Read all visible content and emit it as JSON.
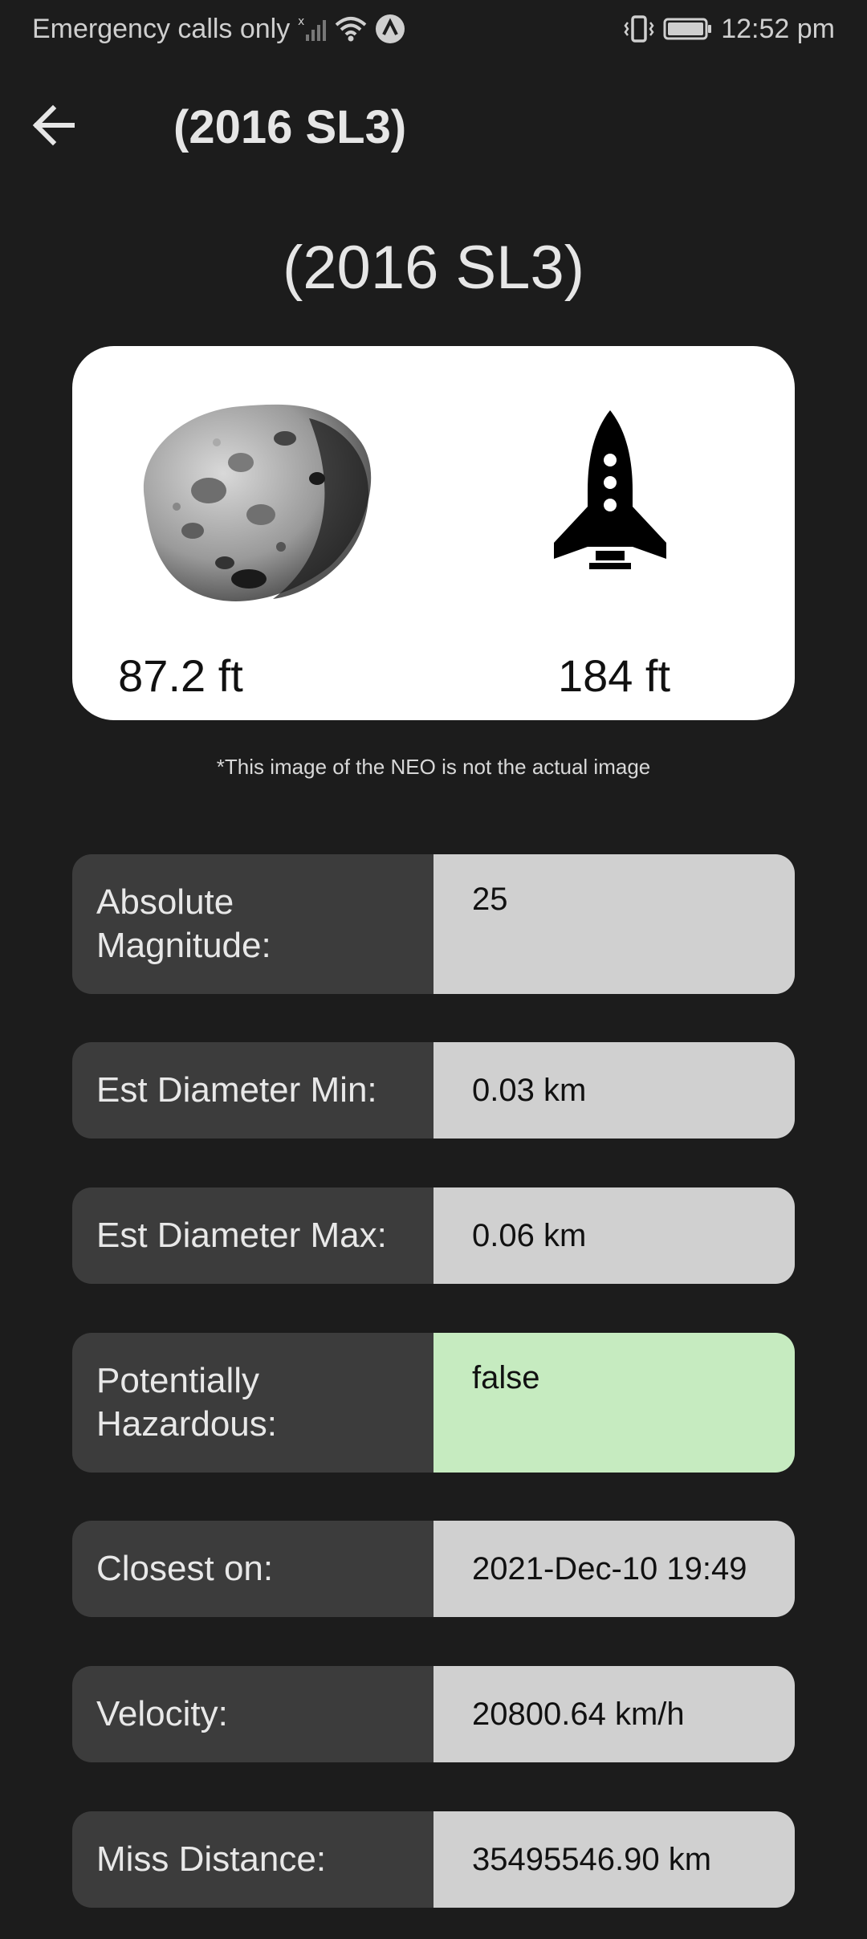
{
  "status_bar": {
    "carrier": "Emergency calls only",
    "time": "12:52 pm",
    "icons": [
      "no-signal-icon",
      "wifi-icon",
      "app-notification-icon",
      "vibrate-icon",
      "battery-icon"
    ]
  },
  "app_bar": {
    "back_icon": "arrow-left-icon",
    "title": "(2016 SL3)"
  },
  "neo": {
    "name": "(2016 SL3)",
    "comparison": {
      "asteroid_size": "87.2 ft",
      "rocket_size": "184 ft",
      "asteroid_icon": "asteroid-icon",
      "rocket_icon": "rocket-icon"
    },
    "disclaimer": "*This image of the NEO is not the actual image"
  },
  "details": [
    {
      "label": "Absolute Magnitude:",
      "value": "25"
    },
    {
      "label": "Est Diameter Min:",
      "value": "0.03 km"
    },
    {
      "label": "Est Diameter Max:",
      "value": "0.06 km"
    },
    {
      "label": "Potentially Hazardous:",
      "value": "false"
    },
    {
      "label": "Closest on:",
      "value": "2021-Dec-10 19:49"
    },
    {
      "label": "Velocity:",
      "value": "20800.64 km/h"
    },
    {
      "label": "Miss Distance:",
      "value": "35495546.90 km"
    }
  ],
  "colors": {
    "background": "#1c1c1c",
    "label_bg": "#3c3c3c",
    "value_bg": "#d0d0d0",
    "safe_bg": "#c6ebc0"
  }
}
